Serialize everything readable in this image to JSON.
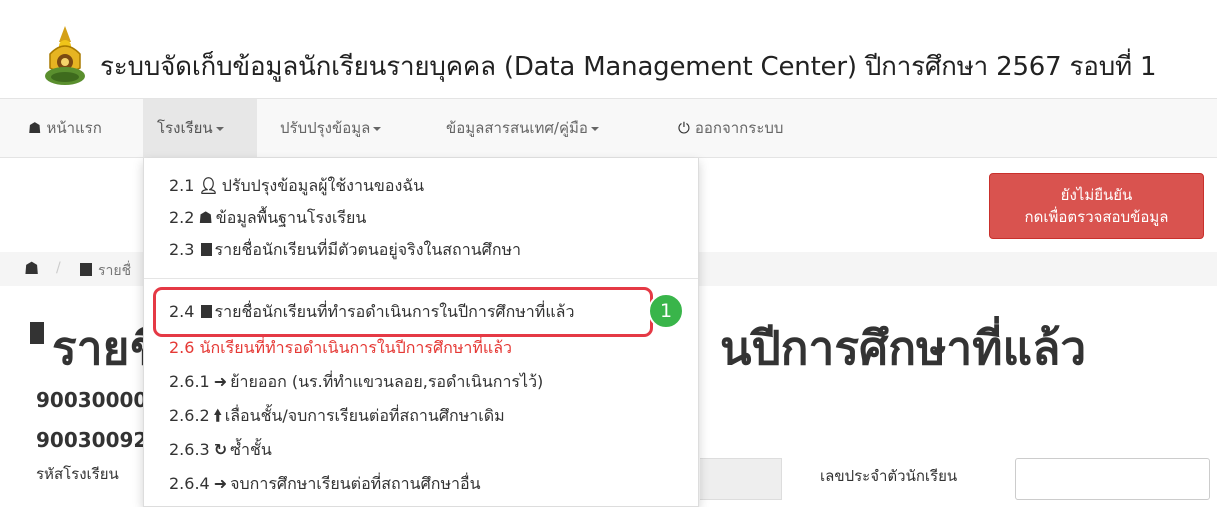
{
  "header": {
    "title": "ระบบจัดเก็บข้อมูลนักเรียนรายบุคคล (Data Management Center) ปีการศึกษา 2567 รอบที่ 1",
    "logo_icon": "school-emblem-icon"
  },
  "navbar": {
    "home": "หน้าแรก",
    "school": "โรงเรียน",
    "update": "ปรับปรุงข้อมูล",
    "info": "ข้อมูลสารสนเทศ/คู่มือ",
    "logout": "ออกจากระบบ"
  },
  "confirm_button": {
    "line1": "ยังไม่ยืนยัน",
    "line2": "กดเพื่อตรวจสอบข้อมูล",
    "color": "#d9534f"
  },
  "breadcrumb": {
    "current": "รายชื่"
  },
  "page": {
    "title_start": "รายชื่",
    "title_end": "นปีการศึกษาที่แล้ว",
    "code1": "90030000",
    "code2": "90030092",
    "school_code_label": "รหัสโรงเรียน",
    "student_id_label": "เลขประจำตัวนักเรียน"
  },
  "dropdown": {
    "items": [
      {
        "id": "2.1",
        "icon": "user-icon",
        "label": "ปรับปรุงข้อมูลผู้ใช้งานของฉัน"
      },
      {
        "id": "2.2",
        "icon": "home-icon",
        "label": "ข้อมูลพื้นฐานโรงเรียน"
      },
      {
        "id": "2.3",
        "icon": "list-icon",
        "label": "รายชื่อนักเรียนที่มีตัวตนอยู่จริงในสถานศึกษา"
      },
      {
        "id": "2.4",
        "icon": "list-icon",
        "label": "รายชื่อนักเรียนที่ทำรอดำเนินการในปีการศึกษาที่แล้ว"
      },
      {
        "id": "2.6",
        "icon": "",
        "label": "นักเรียนที่ทำรอดำเนินการในปีการศึกษาที่แล้ว"
      },
      {
        "id": "2.6.1",
        "icon": "arrow-right-icon",
        "label": "ย้ายออก (นร.ที่ทำแขวนลอย,รอดำเนินการไว้)"
      },
      {
        "id": "2.6.2",
        "icon": "arrow-up-icon",
        "label": "เลื่อนชั้น/จบการเรียนต่อที่สถานศึกษาเดิม"
      },
      {
        "id": "2.6.3",
        "icon": "refresh-icon",
        "label": "ซ้ำชั้น"
      },
      {
        "id": "2.6.4",
        "icon": "arrow-right-icon",
        "label": "จบการศึกษาเรียนต่อที่สถานศึกษาอื่น"
      }
    ],
    "highlight_color": "#e53945",
    "step_badge": "1",
    "step_badge_color": "#39b54a",
    "section_title_color": "#e53935"
  }
}
